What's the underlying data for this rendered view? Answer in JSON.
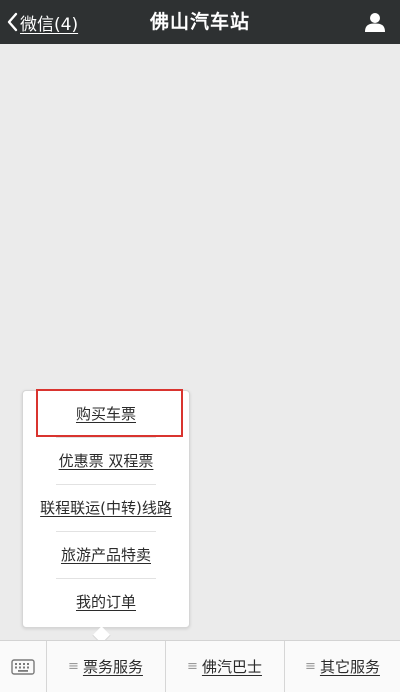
{
  "header": {
    "back_label": "微信(4)",
    "title": "佛山汽车站"
  },
  "menu": {
    "items": [
      {
        "label": "购买车票"
      },
      {
        "label": "优惠票 双程票"
      },
      {
        "label": "联程联运(中转)线路"
      },
      {
        "label": "旅游产品特卖"
      },
      {
        "label": "我的订单"
      }
    ],
    "highlight_color": "#d9342f"
  },
  "bottom_bar": {
    "tabs": [
      {
        "label": "票务服务"
      },
      {
        "label": "佛汽巴士"
      },
      {
        "label": "其它服务"
      }
    ]
  },
  "icons": {
    "back": "chevron-left-icon",
    "profile": "person-icon",
    "keyboard": "keyboard-icon",
    "menu_lines": "menu-lines-icon"
  },
  "colors": {
    "header_bg": "#2e3132",
    "page_bg": "#ebebeb",
    "accent_red": "#d9342f"
  }
}
